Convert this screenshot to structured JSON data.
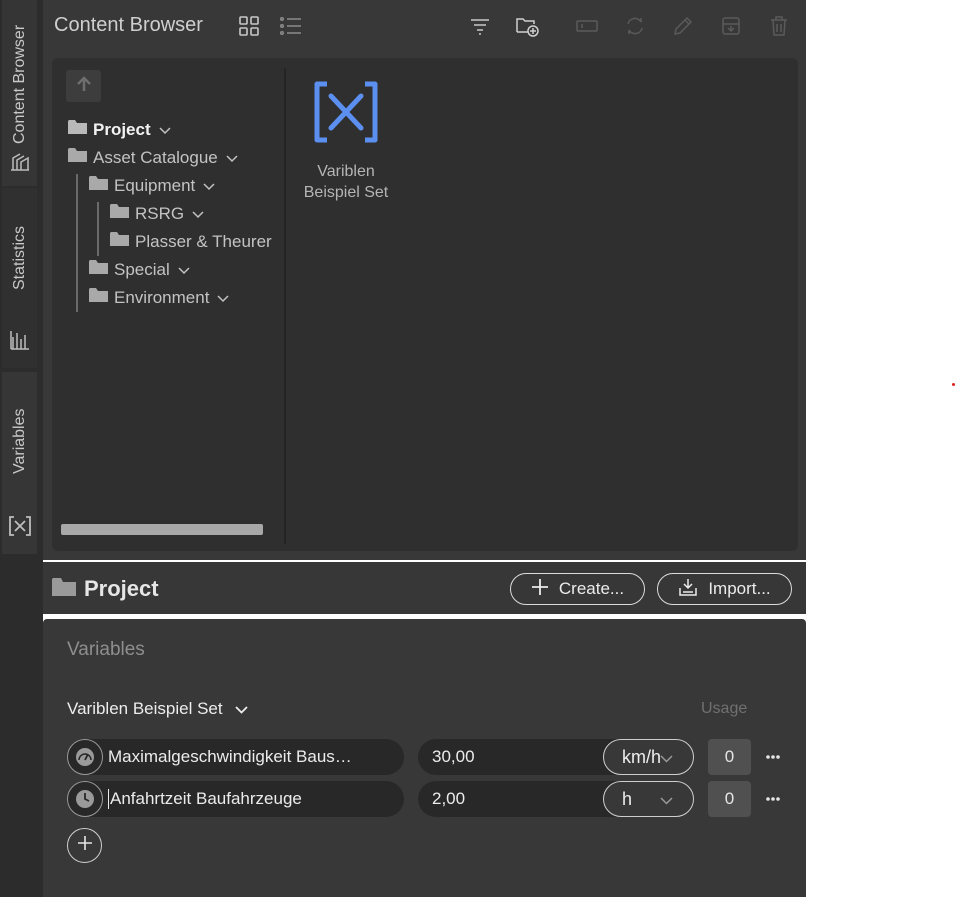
{
  "side_tabs": {
    "content_browser": "Content Browser",
    "statistics": "Statistics",
    "variables": "Variables"
  },
  "content_browser": {
    "title": "Content Browser",
    "tree": {
      "project": "Project",
      "asset_catalogue": "Asset Catalogue",
      "equipment": "Equipment",
      "rsrg": "RSRG",
      "plasser": "Plasser & Theurer",
      "special": "Special",
      "environment": "Environment"
    },
    "asset": {
      "label": "Variblen Beispiel Set",
      "icon": "variable-set-icon",
      "icon_color": "#5b8ff0"
    }
  },
  "project_bar": {
    "title": "Project",
    "create_label": "Create...",
    "import_label": "Import..."
  },
  "variables_panel": {
    "heading": "Variables",
    "set_name": "Variblen Beispiel Set",
    "usage_header": "Usage",
    "rows": [
      {
        "icon": "speedometer-icon",
        "name": "Maximalgeschwindigkeit Baus…",
        "value": "30,00",
        "unit": "km/h",
        "usage": "0"
      },
      {
        "icon": "clock-icon",
        "name": "Anfahrtzeit Baufahrzeuge",
        "value": "2,00",
        "unit": "h",
        "usage": "0"
      }
    ]
  }
}
